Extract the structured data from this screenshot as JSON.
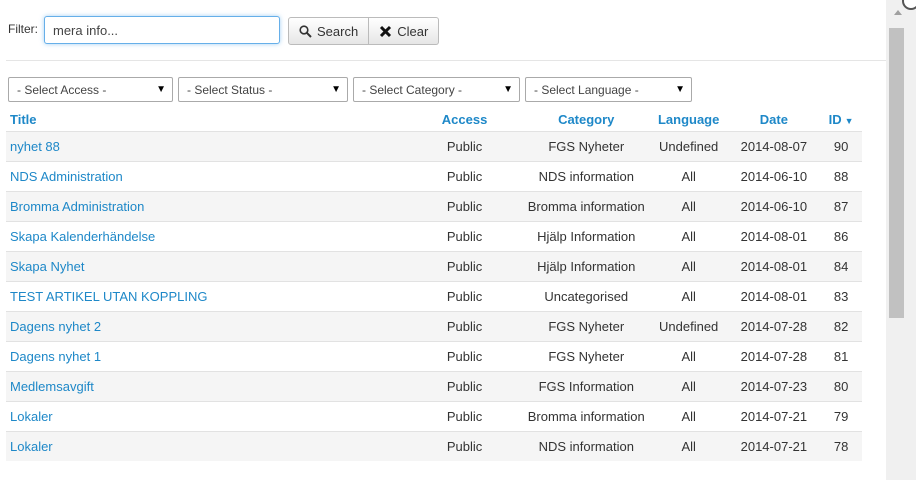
{
  "filter": {
    "label": "Filter:",
    "value": "mera info...",
    "search_label": "Search",
    "clear_label": "Clear"
  },
  "selects": {
    "access": "- Select Access -",
    "status": "- Select Status -",
    "category": "- Select Category -",
    "language": "- Select Language -"
  },
  "columns": {
    "title": "Title",
    "access": "Access",
    "category": "Category",
    "language": "Language",
    "date": "Date",
    "id": "ID"
  },
  "rows": [
    {
      "title": "nyhet 88",
      "access": "Public",
      "category": "FGS Nyheter",
      "language": "Undefined",
      "date": "2014-08-07",
      "id": "90"
    },
    {
      "title": "NDS Administration",
      "access": "Public",
      "category": "NDS information",
      "language": "All",
      "date": "2014-06-10",
      "id": "88"
    },
    {
      "title": "Bromma Administration",
      "access": "Public",
      "category": "Bromma information",
      "language": "All",
      "date": "2014-06-10",
      "id": "87"
    },
    {
      "title": "Skapa Kalenderhändelse",
      "access": "Public",
      "category": "Hjälp Information",
      "language": "All",
      "date": "2014-08-01",
      "id": "86"
    },
    {
      "title": "Skapa Nyhet",
      "access": "Public",
      "category": "Hjälp Information",
      "language": "All",
      "date": "2014-08-01",
      "id": "84"
    },
    {
      "title": "TEST ARTIKEL UTAN KOPPLING",
      "access": "Public",
      "category": "Uncategorised",
      "language": "All",
      "date": "2014-08-01",
      "id": "83"
    },
    {
      "title": "Dagens nyhet 2",
      "access": "Public",
      "category": "FGS Nyheter",
      "language": "Undefined",
      "date": "2014-07-28",
      "id": "82"
    },
    {
      "title": "Dagens nyhet 1",
      "access": "Public",
      "category": "FGS Nyheter",
      "language": "All",
      "date": "2014-07-28",
      "id": "81"
    },
    {
      "title": "Medlemsavgift",
      "access": "Public",
      "category": "FGS Information",
      "language": "All",
      "date": "2014-07-23",
      "id": "80"
    },
    {
      "title": "Lokaler",
      "access": "Public",
      "category": "Bromma information",
      "language": "All",
      "date": "2014-07-21",
      "id": "79"
    },
    {
      "title": "Lokaler",
      "access": "Public",
      "category": "NDS information",
      "language": "All",
      "date": "2014-07-21",
      "id": "78"
    }
  ],
  "colors": {
    "link": "#1e88c8",
    "stripe": "#f5f5f5"
  }
}
